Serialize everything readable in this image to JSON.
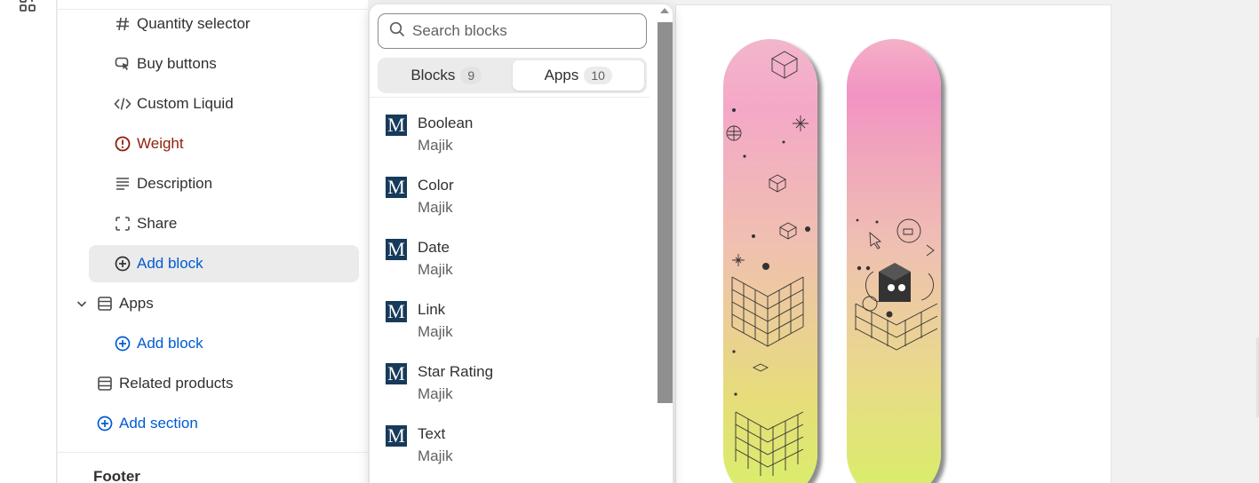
{
  "sidebar": {
    "blocks": [
      {
        "label": "Quantity selector",
        "icon": "hash-icon"
      },
      {
        "label": "Buy buttons",
        "icon": "cursor-icon"
      },
      {
        "label": "Custom Liquid",
        "icon": "code-icon"
      },
      {
        "label": "Weight",
        "icon": "alert-circle-icon",
        "status": "error"
      },
      {
        "label": "Description",
        "icon": "text-align-icon"
      },
      {
        "label": "Share",
        "icon": "share-frame-icon"
      },
      {
        "label": "Add block",
        "icon": "plus-circle-icon"
      }
    ],
    "apps_section": {
      "label": "Apps",
      "add_block": "Add block"
    },
    "related_products": "Related products",
    "add_section": "Add section",
    "footer_title": "Footer"
  },
  "popover": {
    "search_placeholder": "Search blocks",
    "tabs": [
      {
        "label": "Blocks",
        "count": "9",
        "selected": false
      },
      {
        "label": "Apps",
        "count": "10",
        "selected": true
      }
    ],
    "apps": [
      {
        "name": "Boolean",
        "vendor": "Majik"
      },
      {
        "name": "Color",
        "vendor": "Majik"
      },
      {
        "name": "Date",
        "vendor": "Majik"
      },
      {
        "name": "Link",
        "vendor": "Majik"
      },
      {
        "name": "Star Rating",
        "vendor": "Majik"
      },
      {
        "name": "Text",
        "vendor": "Majik"
      }
    ],
    "logo_letter": "M"
  },
  "colors": {
    "link": "#005bd3",
    "error": "#8e1f0b",
    "app_logo": "#163a5a"
  }
}
